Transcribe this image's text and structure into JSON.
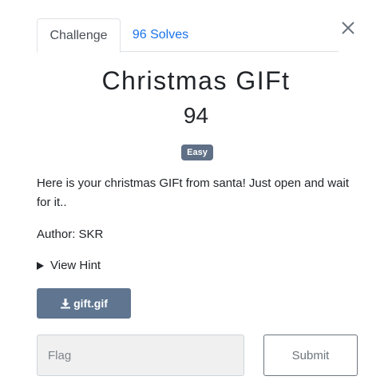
{
  "tabs": [
    {
      "label": "Challenge",
      "active": true
    },
    {
      "label": "96 Solves",
      "active": false
    }
  ],
  "challenge": {
    "title": "Christmas GIFt",
    "value": "94",
    "difficulty": "Easy",
    "description": "Here is your christmas GIFt from santa! Just open and wait for it..",
    "author": "Author: SKR",
    "hint_label": "View Hint",
    "file_label": "gift.gif"
  },
  "form": {
    "flag_placeholder": "Flag",
    "submit_label": "Submit"
  },
  "icons": {
    "close": "close-icon",
    "download": "download-icon",
    "disclosure": "triangle-right-icon"
  },
  "colors": {
    "badge": "#5f6f86",
    "file_button": "#5f7590",
    "link": "#1a73e8"
  }
}
